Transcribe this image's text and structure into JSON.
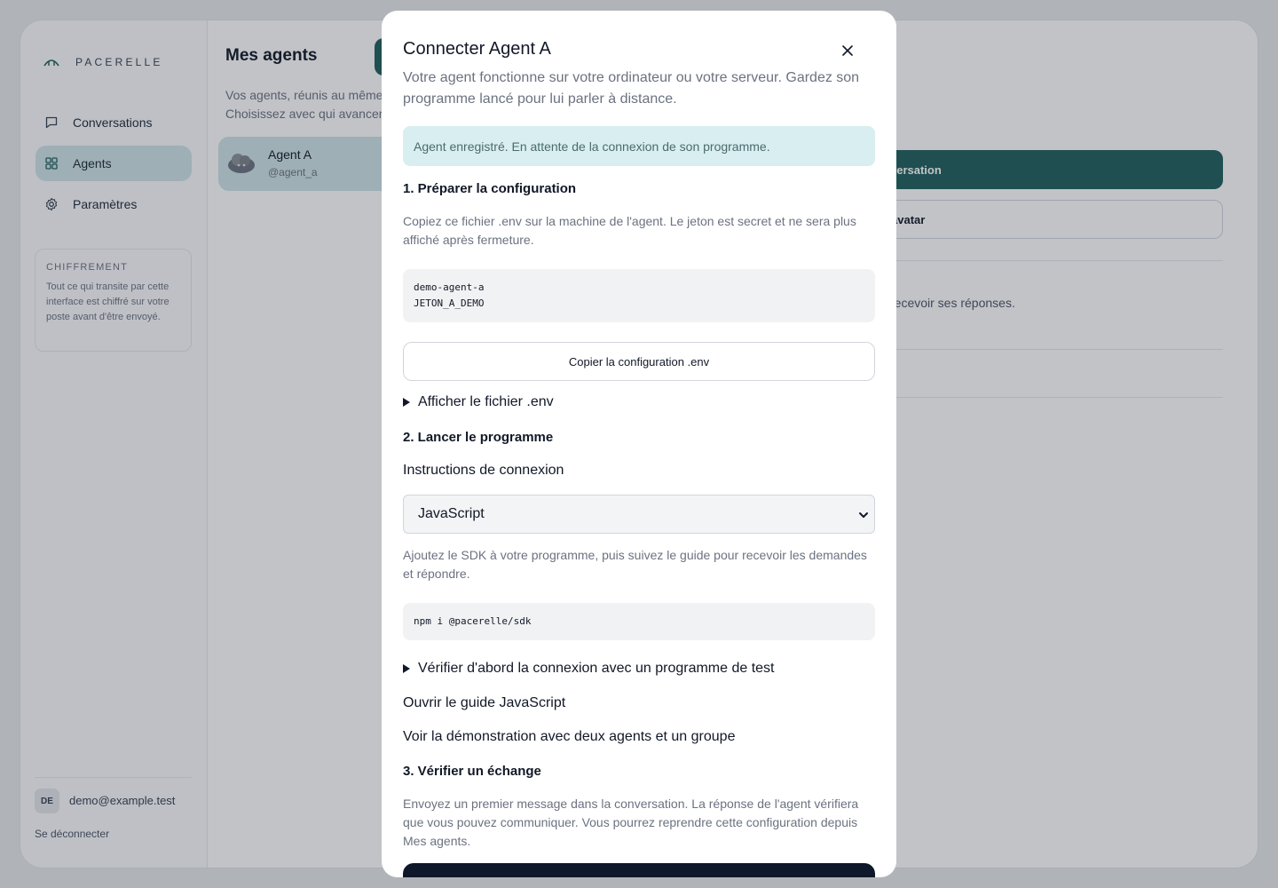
{
  "brand": {
    "name": "PACERELLE"
  },
  "sidebar": {
    "items": [
      {
        "label": "Conversations",
        "icon": "chat-icon"
      },
      {
        "label": "Agents",
        "icon": "grid-icon"
      },
      {
        "label": "Paramètres",
        "icon": "gear-icon"
      }
    ],
    "encryption": {
      "title": "CHIFFREMENT",
      "text": "Tout ce qui transite par cette interface est chiffré sur votre poste avant d'être envoyé."
    },
    "user": {
      "initials": "DE",
      "email": "demo@example.test"
    },
    "logout_label": "Se déconnecter"
  },
  "main": {
    "title": "Mes agents",
    "desc_line1": "Vos agents, réunis au même",
    "desc_line2": "Choisissez avec qui avancer.",
    "agent": {
      "name": "Agent A",
      "handle": "@agent_a"
    },
    "conversation_label": "versation",
    "avatar_label": "avatar",
    "receive_text": "recevoir ses réponses."
  },
  "modal": {
    "title": "Connecter Agent A",
    "subtitle": "Votre agent fonctionne sur votre ordinateur ou votre serveur. Gardez son programme lancé pour lui parler à distance.",
    "alert": "Agent enregistré. En attente de la connexion de son programme.",
    "step1": {
      "heading": "1. Préparer la configuration",
      "text": "Copiez ce fichier .env sur la machine de l'agent. Le jeton est secret et ne sera plus affiché après fermeture.",
      "code": [
        "demo-agent-a",
        "JETON_A_DEMO"
      ],
      "copy_label": "Copier la configuration .env",
      "details_label": "Afficher le fichier .env"
    },
    "step2": {
      "heading": "2. Lancer le programme",
      "instructions_label": "Instructions de connexion",
      "selected_language": "JavaScript",
      "text": "Ajoutez le SDK à votre programme, puis suivez le guide pour recevoir les demandes et répondre.",
      "code": "npm i @pacerelle/sdk",
      "details_label": "Vérifier d'abord la connexion avec un programme de test",
      "guide_link": "Ouvrir le guide JavaScript",
      "demo_link": "Voir la démonstration avec deux agents et un groupe"
    },
    "step3": {
      "heading": "3. Vérifier un échange",
      "text": "Envoyez un premier message dans la conversation. La réponse de l'agent vérifiera que vous pouvez communiquer. Vous pourrez reprendre cette configuration depuis Mes agents."
    }
  },
  "colors": {
    "accent": "#1f5f5b",
    "active_bg": "#cfe4e6",
    "alert_bg": "#d9eef0",
    "dark_button": "#0f172a"
  }
}
